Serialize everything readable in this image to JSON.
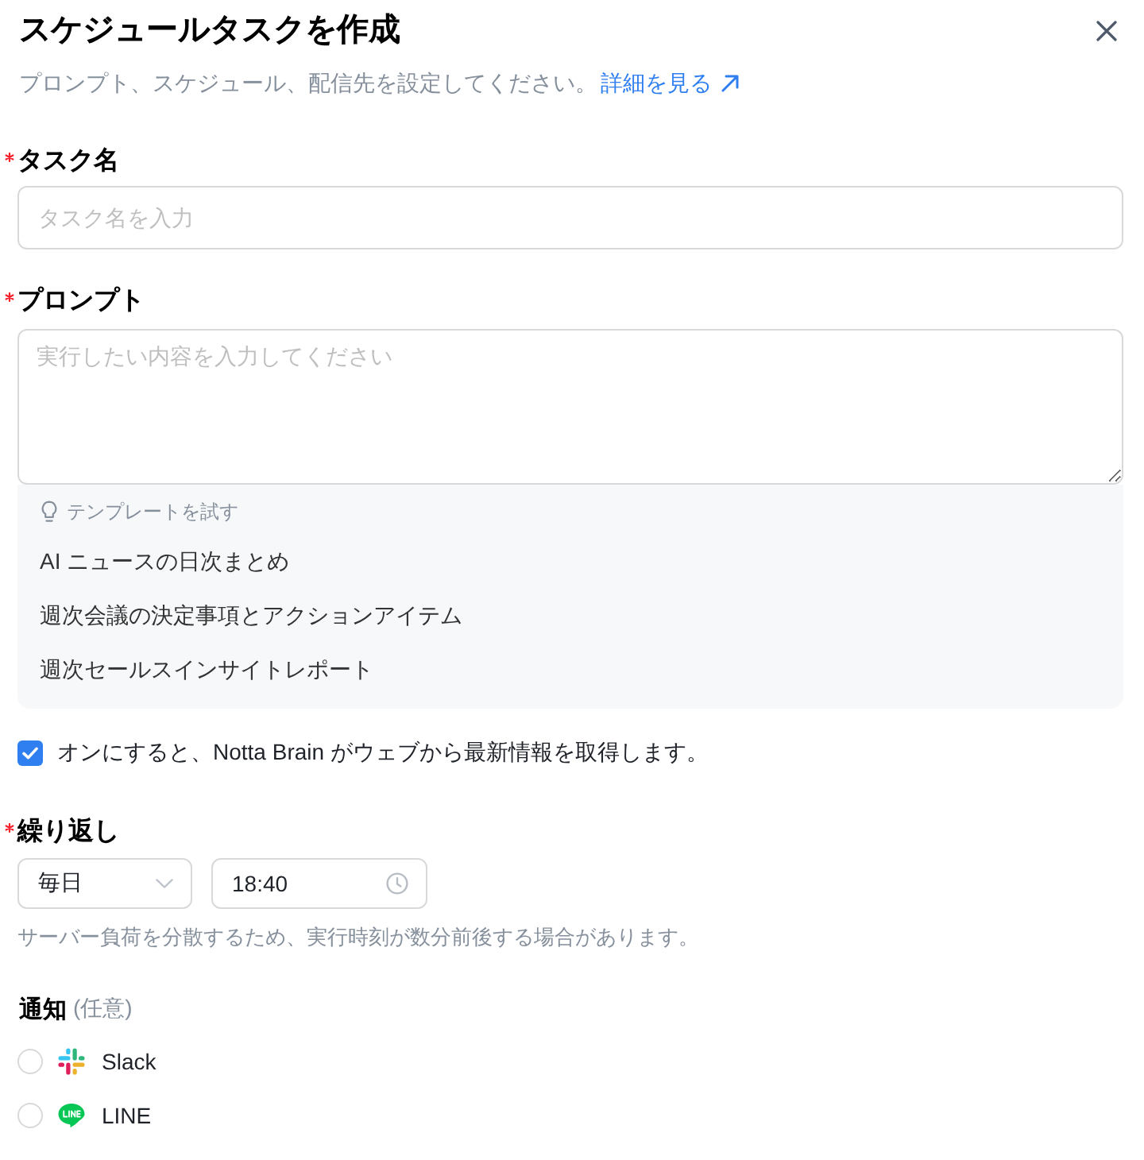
{
  "dialog": {
    "title": "スケジュールタスクを作成",
    "subtitle": "プロンプト、スケジュール、配信先を設定してください。",
    "help_link": "詳細を見る"
  },
  "task_name": {
    "label": "タスク名",
    "required": true,
    "placeholder": "タスク名を入力"
  },
  "prompt": {
    "label": "プロンプト",
    "required": true,
    "placeholder": "実行したい内容を入力してください",
    "templates": {
      "heading": "テンプレートを試す",
      "items": [
        "AI ニュースの日次まとめ",
        "週次会議の決定事項とアクションアイテム",
        "週次セールスインサイトレポート"
      ]
    }
  },
  "web_search": {
    "label": "オンにすると、Notta Brain がウェブから最新情報を取得します。",
    "checked": true
  },
  "repeat": {
    "label": "繰り返し",
    "required": true,
    "frequency": "毎日",
    "time": "18:40",
    "note": "サーバー負荷を分散するため、実行時刻が数分前後する場合があります。"
  },
  "notification": {
    "label": "通知",
    "required": false,
    "optional_note": "(任意)",
    "channels": [
      {
        "kind": "slack",
        "name": "Slack",
        "selected": false
      },
      {
        "kind": "line",
        "name": "LINE",
        "selected": false
      }
    ]
  }
}
